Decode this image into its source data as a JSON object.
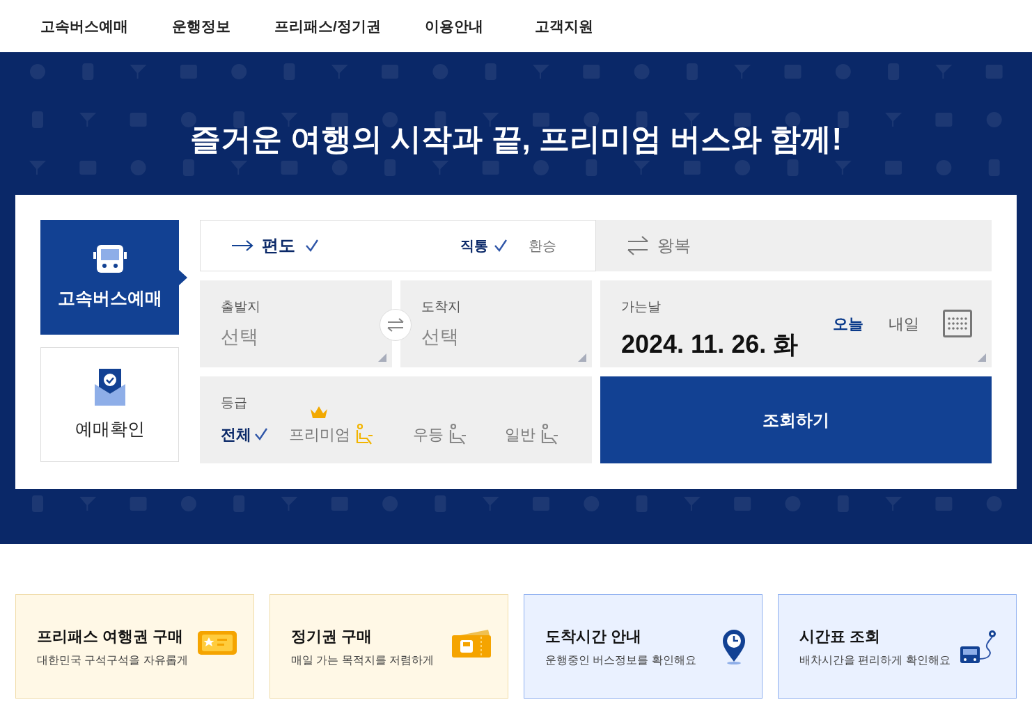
{
  "nav": {
    "items": [
      {
        "label": "고속버스예매"
      },
      {
        "label": "운행정보"
      },
      {
        "label": "프리패스/정기권"
      },
      {
        "label": "이용안내"
      },
      {
        "label": "고객지원"
      }
    ]
  },
  "banner": {
    "title": "즐거운 여행의 시작과 끝, 프리미엄 버스와 함께!"
  },
  "booking_tabs": [
    {
      "label": "고속버스예매",
      "selected": true,
      "kind": "bus"
    },
    {
      "label": "예매확인",
      "selected": false,
      "kind": "ticket"
    }
  ],
  "trip_types": [
    {
      "label": "편도",
      "selected": true,
      "kind": "oneway"
    },
    {
      "label": "왕복",
      "selected": false,
      "kind": "round"
    }
  ],
  "route_options": [
    {
      "label": "직통",
      "selected": true
    },
    {
      "label": "환승",
      "selected": false
    }
  ],
  "origin": {
    "label": "출발지",
    "placeholder": "선택"
  },
  "destination": {
    "label": "도착지",
    "placeholder": "선택"
  },
  "date": {
    "label": "가는날",
    "value": "2024. 11. 26. 화",
    "quick": [
      {
        "label": "오늘",
        "selected": true
      },
      {
        "label": "내일",
        "selected": false
      }
    ]
  },
  "grade": {
    "label": "등급",
    "options": [
      {
        "label": "전체",
        "selected": true,
        "kind": "all"
      },
      {
        "label": "프리미엄",
        "selected": false,
        "kind": "premium"
      },
      {
        "label": "우등",
        "selected": false,
        "kind": "deluxe"
      },
      {
        "label": "일반",
        "selected": false,
        "kind": "standard"
      }
    ]
  },
  "search_button": {
    "label": "조회하기"
  },
  "promo_cards": [
    {
      "title": "프리패스 여행권 구매",
      "subtitle": "대한민국 구석구석을 자유롭게",
      "kind": "freepass"
    },
    {
      "title": "정기권 구매",
      "subtitle": "매일 가는 목적지를 저렴하게",
      "kind": "season"
    },
    {
      "title": "도착시간 안내",
      "subtitle": "운행중인 버스정보를 확인해요",
      "kind": "arrival"
    },
    {
      "title": "시간표 조회",
      "subtitle": "배차시간을 편리하게 확인해요",
      "kind": "timetable"
    }
  ]
}
